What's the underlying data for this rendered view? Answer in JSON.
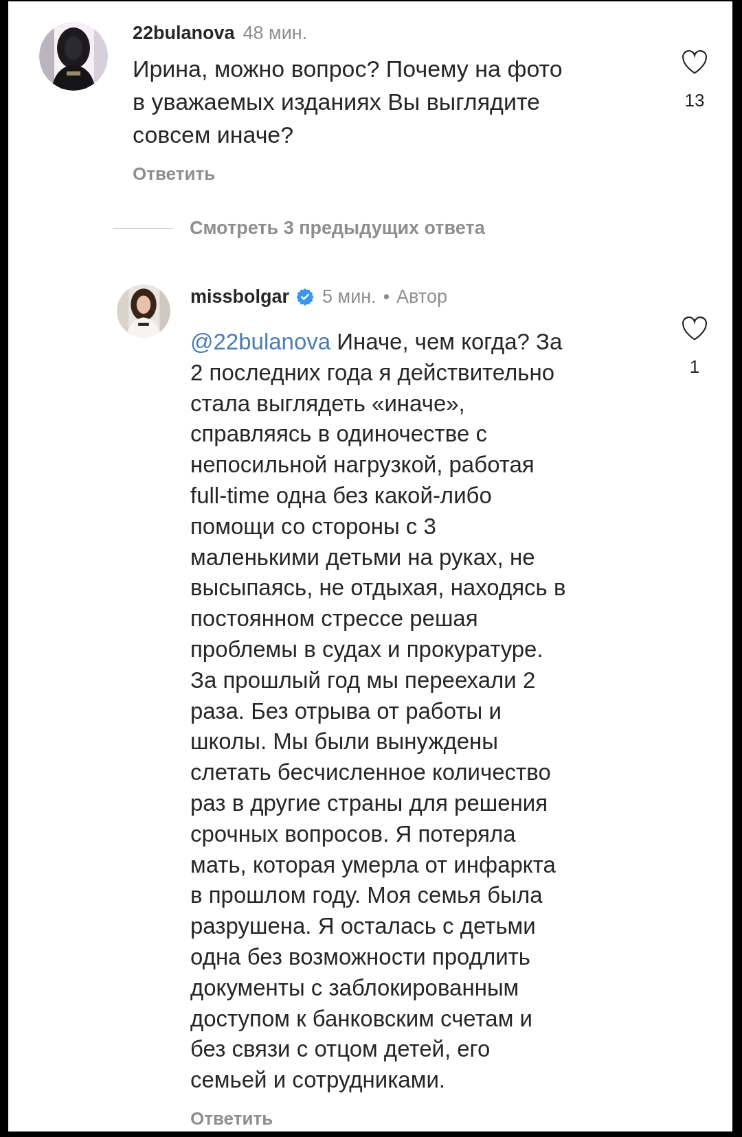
{
  "comments": [
    {
      "author": "22bulanova",
      "verified": false,
      "meta": [
        "48 мин."
      ],
      "text": "Ирина, можно вопрос? Почему на фото\nв уважаемых изданиях Вы выглядите\nсовсем иначе?",
      "liked": false,
      "likes": "13",
      "reply": "Ответить",
      "kind": "comment"
    },
    {
      "author": "missbolgar",
      "verified": true,
      "meta": [
        "5 мин.",
        "•",
        "Автор"
      ],
      "mention": "@22bulanova",
      "text": " Иначе, чем когда? За\n2 последних года я действительно\nстала выглядеть «иначе»,\nсправляясь в одиночестве с\nнепосильной нагрузкой, работая\nfull-time одна без какой-либо\nпомощи со стороны с 3\nмаленькими детьми на руках, не\nвысыпаясь, не отдыхая, находясь в\nпостоянном стрессе решая\nпроблемы в судах и прокуратуре.\nЗа прошлый год мы переехали 2\nраза. Без отрыва от работы и\nшколы. Мы были вынуждены\nслетать бесчисленное количество\nраз в другие страны для решения\nсрочных вопросов. Я потеряла\nмать, которая умерла от инфаркта\nв прошлом году. Моя семья была\nразрушена. Я осталась с детьми\nодна без возможности продлить\nдокументы с заблокированным\nдоступом к банковским счетам и\nбез связи с отцом детей, его\nсемьей и сотрудниками.",
      "liked": false,
      "likes": "1",
      "reply": "Ответить",
      "kind": "reply"
    }
  ],
  "view_replies": "Смотреть 3 предыдущих ответа"
}
